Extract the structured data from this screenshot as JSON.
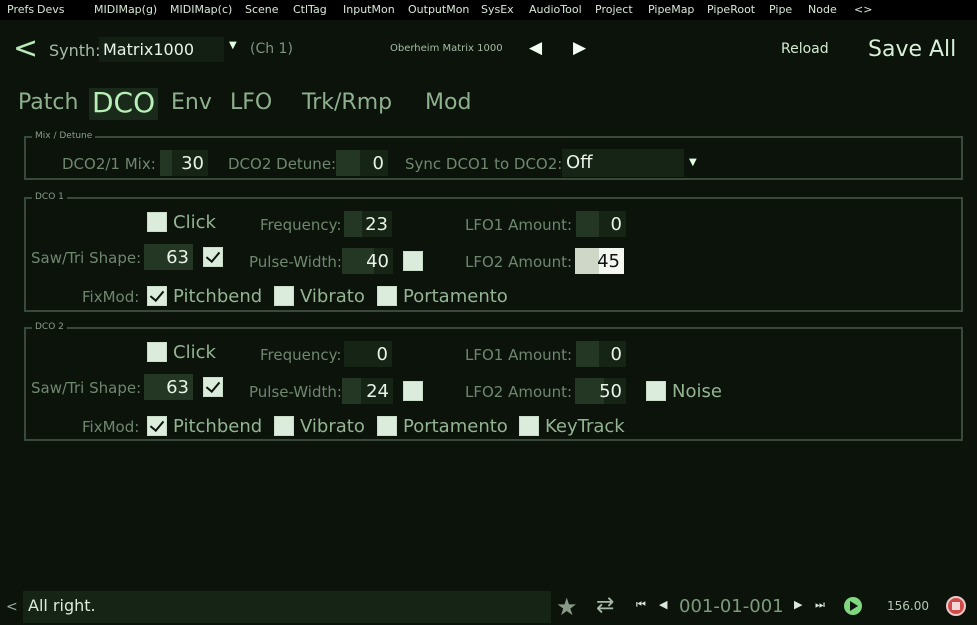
{
  "menu": [
    "Prefs",
    "Devs",
    "MIDIMap(g)",
    "MIDIMap(c)",
    "Scene",
    "CtlTag",
    "InputMon",
    "OutputMon",
    "SysEx",
    "AudioTool",
    "Project",
    "PipeMap",
    "PipeRoot",
    "Pipe",
    "Node",
    "<>"
  ],
  "header": {
    "back": "<",
    "synth_label": "Synth:",
    "synth_value": "Matrix1000",
    "synth_arrow": "▼",
    "channel": "(Ch 1)",
    "device_title": "Oberheim Matrix 1000",
    "prev": "◀",
    "next": "▶",
    "reload": "Reload",
    "save_all": "Save All"
  },
  "tabs": [
    "Patch",
    "DCO",
    "Env",
    "LFO",
    "Trk/Rmp",
    "Mod"
  ],
  "active_tab": "DCO",
  "mix": {
    "title": "Mix / Detune",
    "mix_label": "DCO2/1 Mix:",
    "mix_value": "30",
    "detune_label": "DCO2 Detune:",
    "detune_value": "0",
    "sync_label": "Sync DCO1 to DCO2:",
    "sync_value": "Off",
    "sync_arrow": "▼"
  },
  "dco1": {
    "title": "DCO 1",
    "click_label": "Click",
    "click_checked": false,
    "frequency_label": "Frequency:",
    "frequency_value": "23",
    "lfo1_label": "LFO1 Amount:",
    "lfo1_value": "0",
    "shape_label": "Saw/Tri Shape:",
    "shape_value": "63",
    "shape_checked": true,
    "pw_label": "Pulse-Width:",
    "pw_value": "40",
    "pw_checked": false,
    "lfo2_label": "LFO2 Amount:",
    "lfo2_value": "45",
    "fixmod_label": "FixMod:",
    "pitchbend_label": "Pitchbend",
    "pitchbend_checked": true,
    "vibrato_label": "Vibrato",
    "vibrato_checked": false,
    "portamento_label": "Portamento",
    "portamento_checked": false
  },
  "dco2": {
    "title": "DCO 2",
    "click_label": "Click",
    "click_checked": false,
    "frequency_label": "Frequency:",
    "frequency_value": "0",
    "lfo1_label": "LFO1 Amount:",
    "lfo1_value": "0",
    "shape_label": "Saw/Tri Shape:",
    "shape_value": "63",
    "shape_checked": true,
    "pw_label": "Pulse-Width:",
    "pw_value": "24",
    "pw_checked": false,
    "lfo2_label": "LFO2 Amount:",
    "lfo2_value": "50",
    "noise_label": "Noise",
    "noise_checked": false,
    "fixmod_label": "FixMod:",
    "pitchbend_label": "Pitchbend",
    "pitchbend_checked": true,
    "vibrato_label": "Vibrato",
    "vibrato_checked": false,
    "portamento_label": "Portamento",
    "portamento_checked": false,
    "keytrack_label": "KeyTrack",
    "keytrack_checked": false
  },
  "status": {
    "left_arrow": "<",
    "message": "All right.",
    "star": "★",
    "loop": "⇄",
    "rewind": "⏮",
    "step_back": "◀",
    "position": "001-01-001",
    "step_forward": "▶",
    "forward": "⏭",
    "tempo": "156.00"
  }
}
